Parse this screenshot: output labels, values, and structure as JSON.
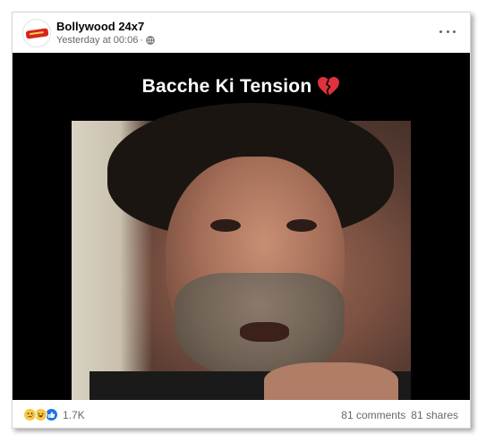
{
  "post": {
    "page_name": "Bollywood 24x7",
    "timestamp": "Yesterday at 00:06",
    "separator": "·",
    "audience_icon": "globe-icon",
    "menu_icon": "more-options-icon"
  },
  "media": {
    "caption": "Bacche Ki Tension",
    "caption_emoji": "broken-heart-icon"
  },
  "footer": {
    "reaction_icons": [
      "sad-reaction-icon",
      "haha-reaction-icon",
      "like-reaction-icon"
    ],
    "reaction_count": "1.7K",
    "comments": "81 comments",
    "shares": "81 shares"
  },
  "colors": {
    "text_primary": "#050505",
    "text_secondary": "#65676b",
    "like_blue": "#1b74e4",
    "reaction_yellow": "#f7c843",
    "heart_red": "#e0323c"
  }
}
